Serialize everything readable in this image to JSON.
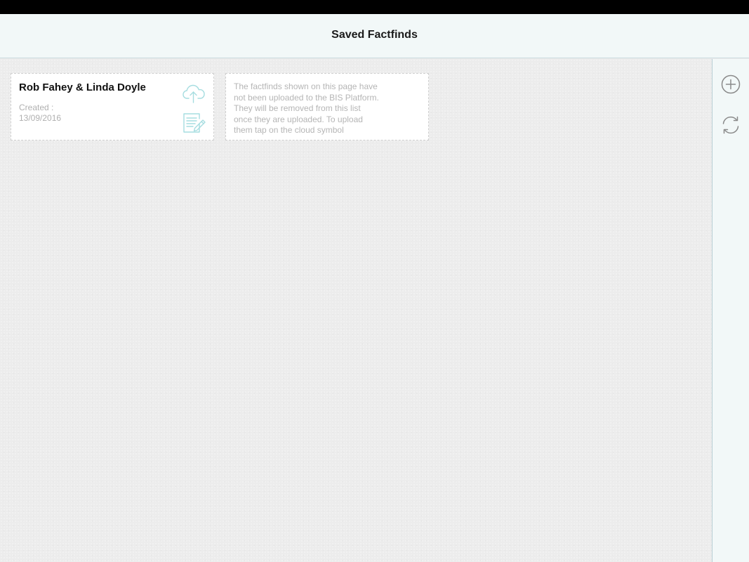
{
  "header": {
    "title": "Saved Factfinds"
  },
  "factfinds": [
    {
      "name": "Rob Fahey & Linda Doyle",
      "created_label": "Created :",
      "created_date": "13/09/2016",
      "upload_icon": "cloud-upload-icon",
      "edit_icon": "edit-document-icon"
    }
  ],
  "info_card": {
    "text": "The factfinds shown on this page have not been uploaded to the BIS Platform. They will be removed from this list once they are uploaded. To upload them tap on the cloud symbol"
  },
  "side_panel": {
    "add_icon": "plus-circle-icon",
    "refresh_icon": "refresh-icon"
  },
  "colors": {
    "accent_icon": "#a6dde0",
    "header_bg": "#f2f8f8",
    "background": "#ececec",
    "muted_text": "#b0b0b0"
  }
}
